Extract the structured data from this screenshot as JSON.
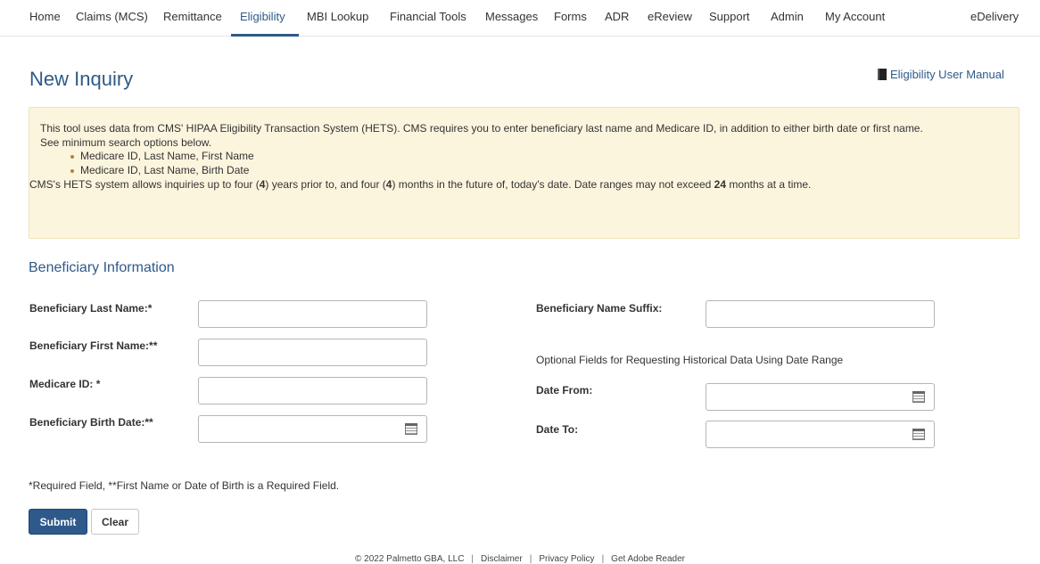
{
  "nav": {
    "items": [
      "Home",
      "Claims (MCS)",
      "Remittance",
      "Eligibility",
      "MBI Lookup",
      "Financial Tools",
      "Messages",
      "Forms",
      "ADR",
      "eReview",
      "Support",
      "Admin",
      "My Account"
    ],
    "right_item": "eDelivery",
    "active": "Eligibility"
  },
  "page": {
    "title": "New Inquiry",
    "manual_link": "Eligibility User Manual",
    "manual_icon": "book-icon"
  },
  "notice": {
    "line1": "This tool uses data from CMS' HIPAA Eligibility Transaction System (HETS). CMS requires you to enter beneficiary last name and Medicare ID, in addition to either birth date or first name.",
    "line2": "See minimum search options below.",
    "bullets": [
      "Medicare ID, Last Name, First Name",
      "Medicare ID, Last Name, Birth Date"
    ],
    "line3_part1": "CMS's HETS system allows inquiries up to four (",
    "line3_bold1": "4",
    "line3_part2": ") years prior to, and four (",
    "line3_bold2": "4",
    "line3_part3": ") months in the future of, today's date. Date ranges may not exceed ",
    "line3_bold3": "24",
    "line3_part4": " months at a time."
  },
  "form": {
    "section_title": "Beneficiary Information",
    "last_name_label": "Beneficiary Last Name:*",
    "first_name_label": "Beneficiary First Name:**",
    "medicare_id_label": "Medicare ID: *",
    "birth_date_label": "Beneficiary Birth Date:**",
    "suffix_label": "Beneficiary Name Suffix:",
    "optional_note": "Optional Fields for Requesting Historical Data Using Date Range",
    "date_from_label": "Date From:",
    "date_to_label": "Date To:",
    "last_name_value": "",
    "first_name_value": "",
    "medicare_id_value": "",
    "birth_date_value": "",
    "suffix_value": "",
    "date_from_value": "",
    "date_to_value": "",
    "footnote": "*Required Field, **First Name or Date of Birth is a Required Field.",
    "submit_label": "Submit",
    "clear_label": "Clear"
  },
  "footer": {
    "copyright": "© 2022 Palmetto GBA, LLC",
    "links": [
      "Disclaimer",
      "Privacy Policy",
      "Get Adobe Reader"
    ]
  },
  "colors": {
    "accent": "#2e5a88",
    "notice_bg": "#fcf5de"
  }
}
